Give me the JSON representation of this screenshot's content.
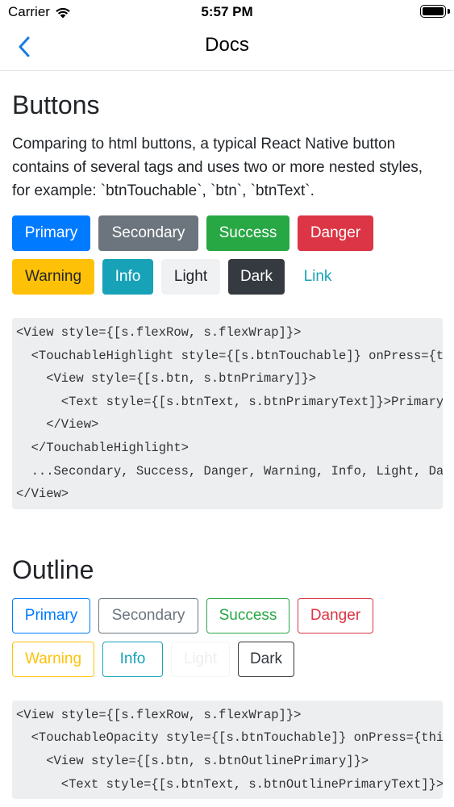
{
  "status_bar": {
    "carrier": "Carrier",
    "time": "5:57 PM",
    "battery_level": 1.0
  },
  "nav": {
    "title": "Docs",
    "back_icon": "chevron-left-icon"
  },
  "colors": {
    "primary": "#007bff",
    "secondary": "#6c757d",
    "success": "#28a745",
    "danger": "#dc3545",
    "warning": "#ffc107",
    "info": "#17a2b8",
    "light": "#f8f9fa",
    "dark": "#343a40",
    "code_background": "#eceef0"
  },
  "buttons_section": {
    "title": "Buttons",
    "description": "Comparing to html buttons, a typical React Native button contains of several tags and uses two or more nested styles, for example: `btnTouchable`, `btn`, `btnText`.",
    "buttons": [
      "Primary",
      "Secondary",
      "Success",
      "Danger",
      "Warning",
      "Info",
      "Light",
      "Dark",
      "Link"
    ],
    "code_lines": [
      "<View style={[s.flexRow, s.flexWrap]}>",
      "  <TouchableHighlight style={[s.btnTouchable]} onPress={this.onPress}>",
      "    <View style={[s.btn, s.btnPrimary]}>",
      "      <Text style={[s.btnText, s.btnPrimaryText]}>Primary</Text>",
      "    </View>",
      "  </TouchableHighlight>",
      "  ...Secondary, Success, Danger, Warning, Info, Light, Dark, Link",
      "</View>"
    ]
  },
  "outline_section": {
    "title": "Outline",
    "buttons": [
      "Primary",
      "Secondary",
      "Success",
      "Danger",
      "Warning",
      "Info",
      "Light",
      "Dark"
    ],
    "code_lines": [
      "<View style={[s.flexRow, s.flexWrap]}>",
      "  <TouchableOpacity style={[s.btnTouchable]} onPress={this.onPress}>",
      "    <View style={[s.btn, s.btnOutlinePrimary]}>",
      "      <Text style={[s.btnText, s.btnOutlinePrimaryText]}>Primary</Text>"
    ]
  }
}
